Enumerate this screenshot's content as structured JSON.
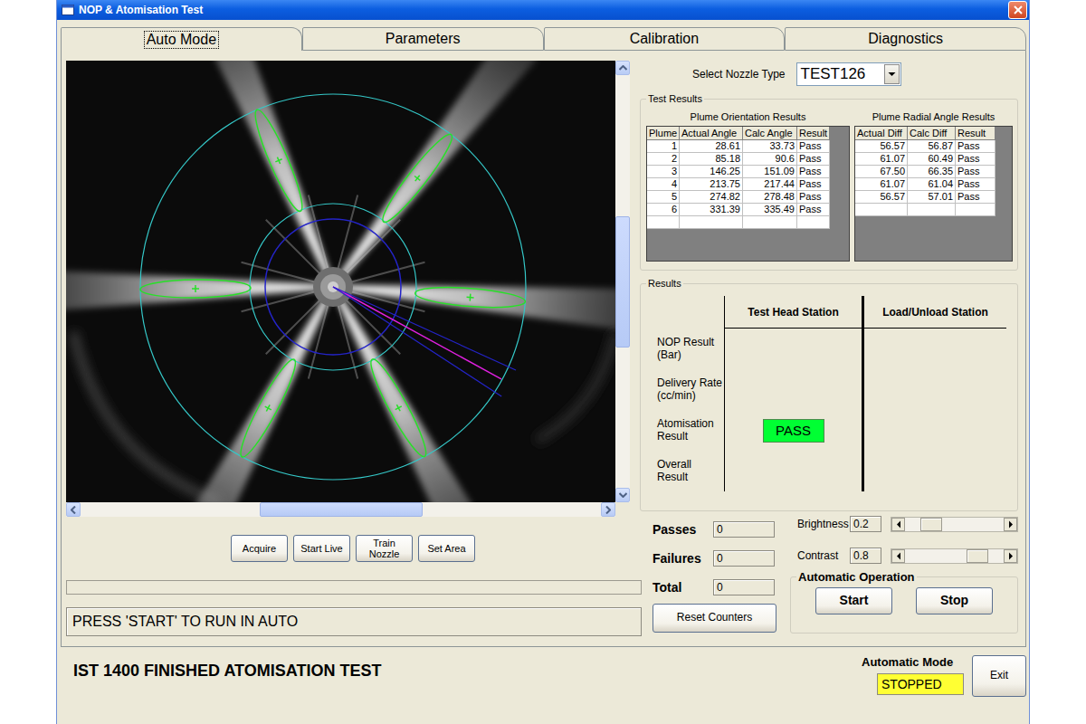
{
  "window": {
    "title": "NOP & Atomisation Test"
  },
  "tabs": [
    {
      "label": "Auto Mode",
      "selected": true
    },
    {
      "label": "Parameters",
      "selected": false
    },
    {
      "label": "Calibration",
      "selected": false
    },
    {
      "label": "Diagnostics",
      "selected": false
    }
  ],
  "image_view": {
    "vertical_scroll_level": 0.5,
    "horizontal_scroll_level": 0.5
  },
  "image_buttons": [
    "Acquire",
    "Start Live",
    "Train Nozzle",
    "Set Area"
  ],
  "progress": {
    "level": 0
  },
  "status_message": "PRESS 'START' TO RUN IN AUTO",
  "nozzle": {
    "label": "Select Nozzle Type",
    "value": "TEST126"
  },
  "test_results": {
    "title": "Test Results",
    "plume_orientation": {
      "title": "Plume Orientation Results",
      "columns": [
        "Plume",
        "Actual Angle",
        "Calc Angle",
        "Result"
      ],
      "rows": [
        [
          "1",
          "28.61",
          "33.73",
          "Pass"
        ],
        [
          "2",
          "85.18",
          "90.6",
          "Pass"
        ],
        [
          "3",
          "146.25",
          "151.09",
          "Pass"
        ],
        [
          "4",
          "213.75",
          "217.44",
          "Pass"
        ],
        [
          "5",
          "274.82",
          "278.48",
          "Pass"
        ],
        [
          "6",
          "331.39",
          "335.49",
          "Pass"
        ]
      ]
    },
    "plume_radial": {
      "title": "Plume Radial Angle Results",
      "columns": [
        "Actual Diff",
        "Calc Diff",
        "Result"
      ],
      "rows": [
        [
          "56.57",
          "56.87",
          "Pass"
        ],
        [
          "61.07",
          "60.49",
          "Pass"
        ],
        [
          "67.50",
          "66.35",
          "Pass"
        ],
        [
          "61.07",
          "61.04",
          "Pass"
        ],
        [
          "56.57",
          "57.01",
          "Pass"
        ]
      ]
    }
  },
  "results": {
    "title": "Results",
    "columns": [
      "Test Head Station",
      "Load/Unload Station"
    ],
    "rows": [
      {
        "label": [
          "NOP Result",
          "(Bar)"
        ],
        "test_head": null,
        "load_unload": null
      },
      {
        "label": [
          "Delivery Rate",
          "(cc/min)"
        ],
        "test_head": null,
        "load_unload": null
      },
      {
        "label": [
          "Atomisation",
          "Result"
        ],
        "test_head": {
          "text": "PASS",
          "color": "#00ff33"
        },
        "load_unload": null
      },
      {
        "label": [
          "Overall",
          "Result"
        ],
        "test_head": null,
        "load_unload": null
      }
    ]
  },
  "counters": [
    {
      "label": "Passes",
      "value": "0"
    },
    {
      "label": "Failures",
      "value": "0"
    },
    {
      "label": "Total",
      "value": "0"
    }
  ],
  "reset_button": "Reset Counters",
  "sliders": [
    {
      "label": "Brightness",
      "value": "0.2",
      "level": 0.2
    },
    {
      "label": "Contrast",
      "value": "0.8",
      "level": 0.8
    }
  ],
  "automatic_operation": {
    "title": "Automatic Operation",
    "buttons": [
      "Start",
      "Stop"
    ]
  },
  "status_bar": {
    "message": "IST 1400 FINISHED ATOMISATION TEST",
    "mode_label": "Automatic Mode",
    "mode_value": "STOPPED",
    "exit_button": "Exit"
  }
}
